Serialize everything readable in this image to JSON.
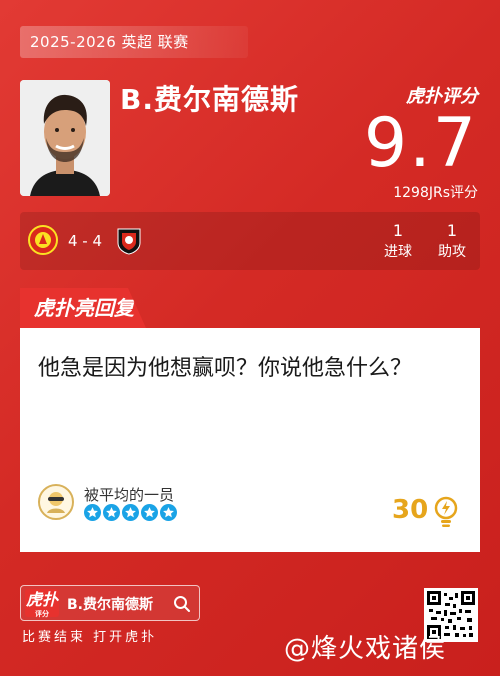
{
  "header": {
    "season_label": "2025-2026 英超 联赛",
    "player_name": "B.费尔南德斯",
    "brand_rating_label": "虎扑评分",
    "score": "9.7",
    "rating_count": "1298JRs评分"
  },
  "match": {
    "score": "4 - 4",
    "goals_value": "1",
    "goals_label": "进球",
    "assists_value": "1",
    "assists_label": "助攻"
  },
  "reply": {
    "tab_label": "虎扑亮回复",
    "text": "他急是因为他想赢呗？你说他急什么？",
    "user_title": "被平均的一员",
    "star_count": 5,
    "likes": "30"
  },
  "footer": {
    "logo_text": "虎扑",
    "logo_sub": "评分",
    "search_name": "B.费尔南德斯",
    "hint": "比赛结束 打开虎扑",
    "watermark": "@烽火戏诸侯"
  },
  "colors": {
    "background": "#d42a25",
    "accent_gold": "#e6a51c",
    "star_blue": "#1aa3e6"
  }
}
